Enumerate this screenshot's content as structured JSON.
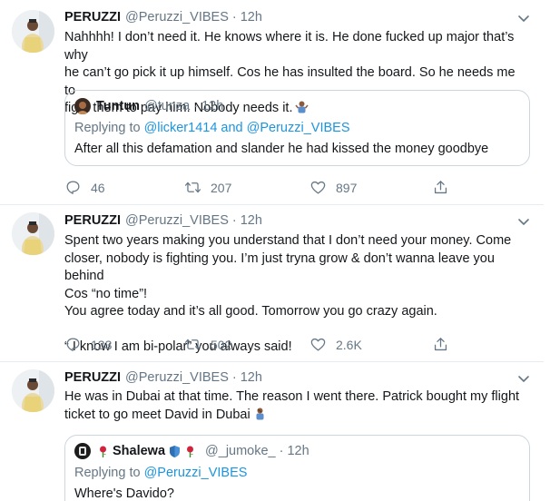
{
  "tweets": [
    {
      "name": "PERUZZI",
      "handle": "@Peruzzi_VIBES",
      "dot": "·",
      "time": "12h",
      "text_lines": [
        "Nahhhh! I don’t need it. He knows where it is. He done fucked up major that’s why",
        "he can’t go pick it up himself. Cos he has insulted the board. So he needs me to",
        "fight them to pay him. Nobody needs it."
      ],
      "quote": {
        "name": "Tuntun",
        "handle": "@tunza",
        "dot": "·",
        "time": "12h",
        "replying_prefix": "Replying to",
        "replying_users": "@licker1414 and @Peruzzi_VIBES",
        "text": "After all this defamation and slander he had kissed the money goodbye"
      },
      "replies": "46",
      "retweets": "207",
      "likes": "897"
    },
    {
      "name": "PERUZZI",
      "handle": "@Peruzzi_VIBES",
      "dot": "·",
      "time": "12h",
      "text_lines": [
        "Spent two years making you understand that I don’t need your money. Come",
        "closer, nobody is fighting you. I’m just tryna grow & don’t wanna leave you behind",
        "Cos “no time”!",
        "You agree today and it’s all good. Tomorrow you go crazy again.",
        "",
        "“ I know I am bi-polar” you always said!"
      ],
      "replies": "133",
      "retweets": "502",
      "likes": "2.6K"
    },
    {
      "name": "PERUZZI",
      "handle": "@Peruzzi_VIBES",
      "dot": "·",
      "time": "12h",
      "text_lines": [
        "He was in Dubai at that time. The reason I went there. Patrick bought my flight",
        "ticket to go meet David in Dubai"
      ],
      "quote": {
        "name": "Shalewa",
        "handle": "@_jumoke_",
        "dot": "·",
        "time": "12h",
        "replying_prefix": "Replying to",
        "replying_users": "@Peruzzi_VIBES",
        "text": "Where's Davido?"
      }
    }
  ],
  "icons": {
    "reply": "reply-icon",
    "retweet": "retweet-icon",
    "like": "like-icon",
    "share": "share-icon",
    "more": "chevron-down-icon",
    "emoji_shrug": "person-shrugging-emoji",
    "emoji_facepalm": "person-facepalming-emoji",
    "emoji_rose": "rose-emoji",
    "emoji_shield": "shield-emoji",
    "emoji_skull": "skull-emoji"
  },
  "colors": {
    "text": "#14171a",
    "secondary": "#657786",
    "link": "#1b95e0",
    "border": "#e6ecf0"
  }
}
